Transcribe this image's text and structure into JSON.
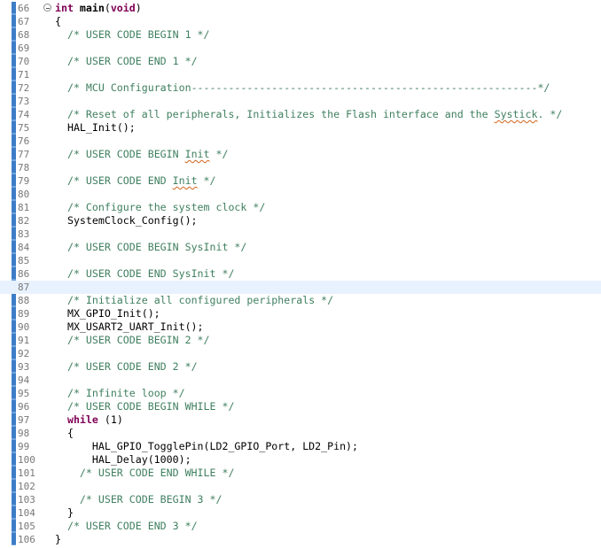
{
  "editor": {
    "current_line": 87,
    "lines": [
      {
        "n": "66",
        "fold": true,
        "segs": [
          [
            "kw",
            "int "
          ],
          [
            "fn",
            "main"
          ],
          [
            "",
            "("
          ],
          [
            "kw",
            "void"
          ],
          [
            "",
            ")"
          ]
        ]
      },
      {
        "n": "67",
        "segs": [
          [
            "",
            "{"
          ]
        ]
      },
      {
        "n": "68",
        "segs": [
          [
            "",
            "  "
          ],
          [
            "cm",
            "/* USER CODE BEGIN 1 */"
          ]
        ]
      },
      {
        "n": "69",
        "segs": []
      },
      {
        "n": "70",
        "segs": [
          [
            "",
            "  "
          ],
          [
            "cm",
            "/* USER CODE END 1 */"
          ]
        ]
      },
      {
        "n": "71",
        "segs": []
      },
      {
        "n": "72",
        "segs": [
          [
            "",
            "  "
          ],
          [
            "cm",
            "/* MCU Configuration--------------------------------------------------------*/"
          ]
        ]
      },
      {
        "n": "73",
        "segs": []
      },
      {
        "n": "74",
        "segs": [
          [
            "",
            "  "
          ],
          [
            "cm",
            "/* Reset of all peripherals, Initializes the Flash interface and the "
          ],
          [
            "cm sq",
            "Systick"
          ],
          [
            "cm",
            ". */"
          ]
        ]
      },
      {
        "n": "75",
        "segs": [
          [
            "",
            "  HAL_Init();"
          ]
        ]
      },
      {
        "n": "76",
        "segs": []
      },
      {
        "n": "77",
        "segs": [
          [
            "",
            "  "
          ],
          [
            "cm",
            "/* USER CODE BEGIN "
          ],
          [
            "cm sq",
            "Init"
          ],
          [
            "cm",
            " */"
          ]
        ]
      },
      {
        "n": "78",
        "segs": []
      },
      {
        "n": "79",
        "segs": [
          [
            "",
            "  "
          ],
          [
            "cm",
            "/* USER CODE END "
          ],
          [
            "cm sq",
            "Init"
          ],
          [
            "cm",
            " */"
          ]
        ]
      },
      {
        "n": "80",
        "segs": []
      },
      {
        "n": "81",
        "segs": [
          [
            "",
            "  "
          ],
          [
            "cm",
            "/* Configure the system clock */"
          ]
        ]
      },
      {
        "n": "82",
        "segs": [
          [
            "",
            "  SystemClock_Config();"
          ]
        ]
      },
      {
        "n": "83",
        "segs": []
      },
      {
        "n": "84",
        "segs": [
          [
            "",
            "  "
          ],
          [
            "cm",
            "/* USER CODE BEGIN SysInit */"
          ]
        ]
      },
      {
        "n": "85",
        "segs": []
      },
      {
        "n": "86",
        "segs": [
          [
            "",
            "  "
          ],
          [
            "cm",
            "/* USER CODE END SysInit */"
          ]
        ]
      },
      {
        "n": "87",
        "segs": []
      },
      {
        "n": "88",
        "segs": [
          [
            "",
            "  "
          ],
          [
            "cm",
            "/* Initialize all configured peripherals */"
          ]
        ]
      },
      {
        "n": "89",
        "segs": [
          [
            "",
            "  MX_GPIO_Init();"
          ]
        ]
      },
      {
        "n": "90",
        "segs": [
          [
            "",
            "  MX_USART2_UART_Init();"
          ]
        ]
      },
      {
        "n": "91",
        "segs": [
          [
            "",
            "  "
          ],
          [
            "cm",
            "/* USER CODE BEGIN 2 */"
          ]
        ]
      },
      {
        "n": "92",
        "segs": []
      },
      {
        "n": "93",
        "segs": [
          [
            "",
            "  "
          ],
          [
            "cm",
            "/* USER CODE END 2 */"
          ]
        ]
      },
      {
        "n": "94",
        "segs": []
      },
      {
        "n": "95",
        "segs": [
          [
            "",
            "  "
          ],
          [
            "cm",
            "/* Infinite loop */"
          ]
        ]
      },
      {
        "n": "96",
        "segs": [
          [
            "",
            "  "
          ],
          [
            "cm",
            "/* USER CODE BEGIN WHILE */"
          ]
        ]
      },
      {
        "n": "97",
        "segs": [
          [
            "",
            "  "
          ],
          [
            "kw",
            "while"
          ],
          [
            "",
            " (1)"
          ]
        ]
      },
      {
        "n": "98",
        "segs": [
          [
            "",
            "  {"
          ]
        ]
      },
      {
        "n": "99",
        "segs": [
          [
            "",
            "      HAL_GPIO_TogglePin(LD2_GPIO_Port, LD2_Pin);"
          ]
        ]
      },
      {
        "n": "100",
        "segs": [
          [
            "",
            "      HAL_Delay(1000);"
          ]
        ]
      },
      {
        "n": "101",
        "segs": [
          [
            "",
            "    "
          ],
          [
            "cm",
            "/* USER CODE END WHILE */"
          ]
        ]
      },
      {
        "n": "102",
        "segs": []
      },
      {
        "n": "103",
        "segs": [
          [
            "",
            "    "
          ],
          [
            "cm",
            "/* USER CODE BEGIN 3 */"
          ]
        ]
      },
      {
        "n": "104",
        "segs": [
          [
            "",
            "  }"
          ]
        ]
      },
      {
        "n": "105",
        "segs": [
          [
            "",
            "  "
          ],
          [
            "cm",
            "/* USER CODE END 3 */"
          ]
        ]
      },
      {
        "n": "106",
        "segs": [
          [
            "",
            "}"
          ]
        ]
      }
    ]
  }
}
